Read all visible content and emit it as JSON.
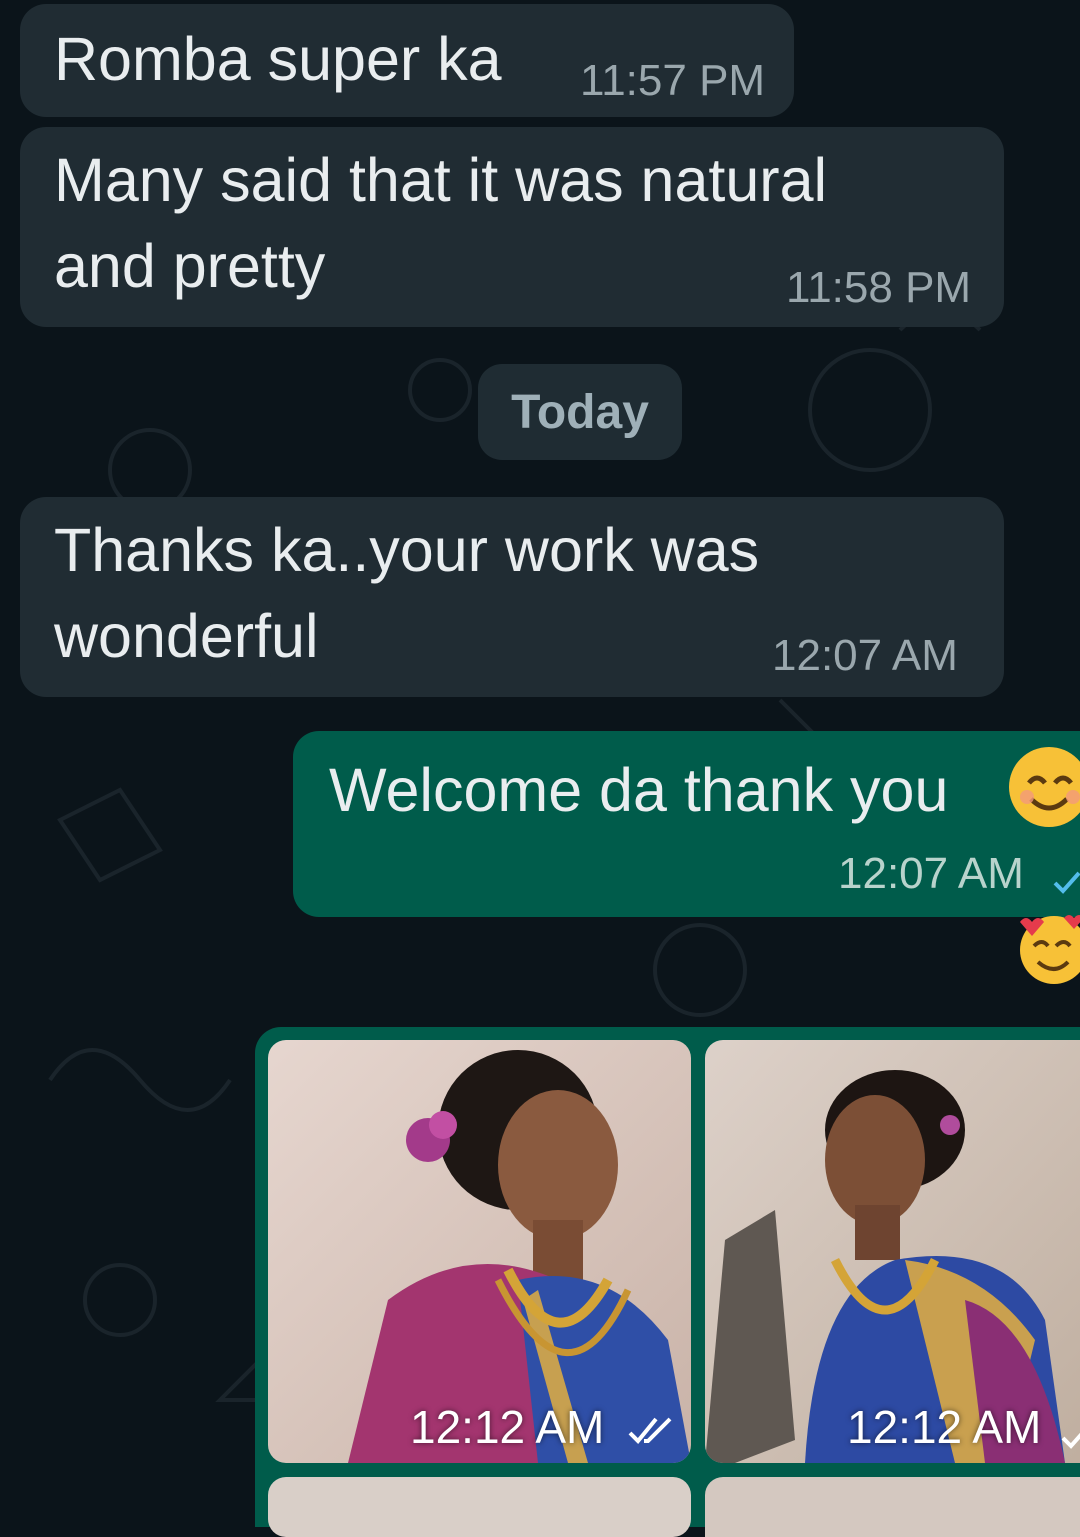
{
  "messages": [
    {
      "id": "m1",
      "direction": "incoming",
      "lines": [
        "Romba super ka"
      ],
      "time": "11:57 PM"
    },
    {
      "id": "m2",
      "direction": "incoming",
      "lines": [
        "Many said that it was natural",
        "and pretty"
      ],
      "time": "11:58 PM"
    },
    {
      "id": "m3",
      "direction": "incoming",
      "lines": [
        "Thanks ka..your work was",
        "wonderful"
      ],
      "time": "12:07 AM"
    },
    {
      "id": "m4",
      "direction": "outgoing",
      "lines": [
        "Welcome da thank you"
      ],
      "time": "12:07 AM",
      "status": "sent",
      "emoji": "smiling-face-icon"
    }
  ],
  "date_divider": "Today",
  "reaction": {
    "emoji": "smiling-face-with-hearts-icon"
  },
  "media": [
    {
      "time": "12:12 AM",
      "status": "read"
    },
    {
      "time": "12:12 AM",
      "status": "sent"
    }
  ],
  "colors": {
    "background": "#0b141a",
    "incoming_bubble": "#202c33",
    "outgoing_bubble": "#005c4b",
    "read_tick": "#53bdeb"
  }
}
